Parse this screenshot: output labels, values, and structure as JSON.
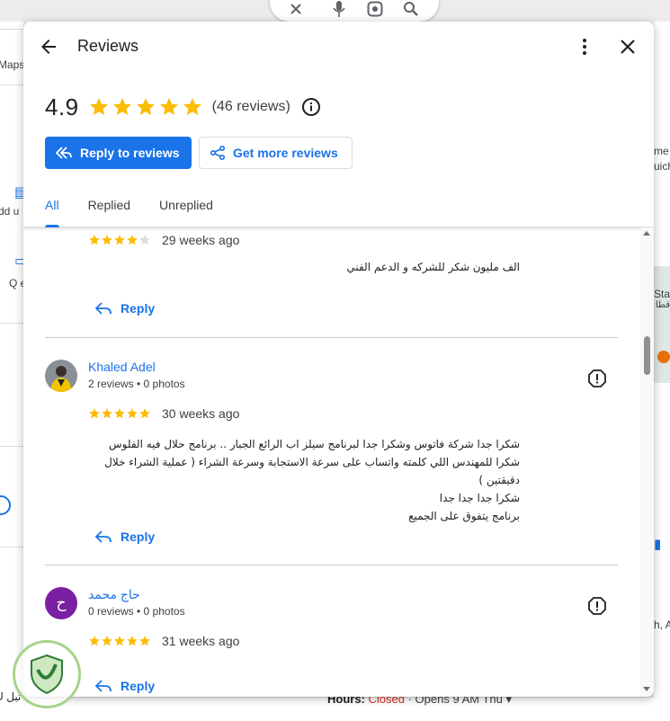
{
  "background": {
    "left_labels": [
      "Maps",
      "dd u",
      "Q e"
    ],
    "right_labels": [
      "me",
      "uich",
      "Sta",
      "قطا",
      "h, A",
      "th"
    ],
    "hours_label": "Hours:",
    "hours_status": "Closed",
    "hours_opens": "· Opens 9 AM Thu ▾",
    "bottom_left_text": "تبل ك"
  },
  "dialog": {
    "title": "Reviews",
    "summary": {
      "rating": "4.9",
      "stars": 5,
      "review_count_text": "(46 reviews)"
    },
    "actions": {
      "reply_to_reviews": "Reply to reviews",
      "get_more_reviews": "Get more reviews"
    },
    "tabs": [
      {
        "label": "All",
        "active": true
      },
      {
        "label": "Replied",
        "active": false
      },
      {
        "label": "Unreplied",
        "active": false
      }
    ],
    "reviews": [
      {
        "name": "",
        "meta": "",
        "stars": 4,
        "date": "29 weeks ago",
        "text": [
          "الف مليون شكر للشركه و الدعم الفني"
        ],
        "reply_label": "Reply"
      },
      {
        "name": "Khaled Adel",
        "meta": "2 reviews • 0 photos",
        "stars": 5,
        "date": "30 weeks ago",
        "text": [
          "شكرا جدا شركة فاتوس وشكرا جدا لبرنامج سيلز اب الرائع الجبار .. برنامج حلال فيه الفلوس",
          "شكرا للمهندس اللي كلمته واتساب على سرعة الاستجابة وسرعة الشراء ( عملية الشراء خلال دقيقتين )",
          "شكرا جدا جدا جدا",
          "برنامج يتفوق على الجميع"
        ],
        "reply_label": "Reply"
      },
      {
        "name": "حاج محمد",
        "avatar_letter": "ح",
        "meta": "0 reviews • 0 photos",
        "stars": 5,
        "date": "31 weeks ago",
        "text": [],
        "reply_label": "Reply"
      }
    ]
  },
  "colors": {
    "accent": "#1a73e8",
    "star": "#fbbc04",
    "star_empty": "#dadce0",
    "avatar_purple": "#7b1fa2",
    "closed": "#d93025"
  },
  "icons": {
    "back": "arrow-back-icon",
    "more": "more-vert-icon",
    "close": "close-icon",
    "info": "info-icon",
    "reply": "reply-icon",
    "share": "share-icon",
    "flag": "report-icon",
    "star": "star-icon"
  }
}
